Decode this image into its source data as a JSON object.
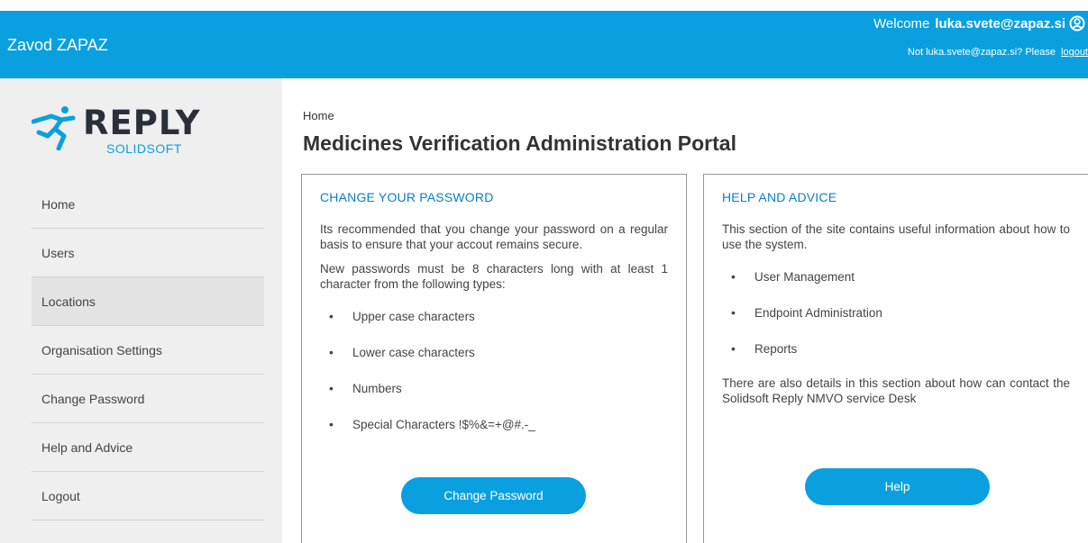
{
  "header": {
    "org_name": "Zavod ZAPAZ",
    "welcome_label": "Welcome",
    "username": "luka.svete@zapaz.si",
    "not_user_text": "Not luka.svete@zapaz.si?  Please",
    "logout_link": "logout"
  },
  "logo": {
    "word": "REPLY",
    "sub": "SOLIDSOFT"
  },
  "sidebar": {
    "items": [
      {
        "label": "Home"
      },
      {
        "label": "Users"
      },
      {
        "label": "Locations"
      },
      {
        "label": "Organisation Settings"
      },
      {
        "label": "Change Password"
      },
      {
        "label": "Help and Advice"
      },
      {
        "label": "Logout"
      }
    ]
  },
  "main": {
    "breadcrumb": "Home",
    "title": "Medicines Verification Administration Portal"
  },
  "password_card": {
    "heading": "CHANGE YOUR PASSWORD",
    "para1": "Its recommended that you change your password on a regular basis to ensure that your accout remains secure.",
    "para2": "New passwords must be 8 characters long with at least 1 character from the following types:",
    "items": [
      "Upper case characters",
      "Lower case characters",
      "Numbers",
      "Special Characters !$%&=+@#.-_"
    ],
    "button": "Change Password"
  },
  "help_card": {
    "heading": "HELP AND ADVICE",
    "para1": "This section of the site contains useful information about how to use the system.",
    "items": [
      "User Management",
      "Endpoint Administration",
      "Reports"
    ],
    "para2": "There are also details in this section about how can contact the Solidsoft Reply NMVO service Desk",
    "button": "Help"
  },
  "colors": {
    "accent": "#0aa0e0",
    "heading_blue": "#0a7fc2",
    "sidebar_bg": "#efefef"
  },
  "icons": {
    "user": "user-circle-icon",
    "logo_mark": "running-figure-icon"
  }
}
